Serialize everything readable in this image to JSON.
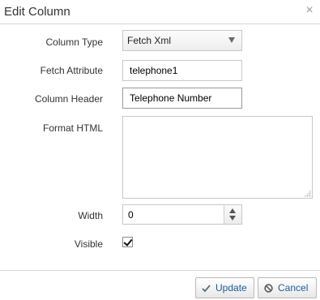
{
  "dialog": {
    "title": "Edit Column",
    "close_glyph": "×"
  },
  "form": {
    "column_type": {
      "label": "Column Type",
      "value": "Fetch Xml"
    },
    "fetch_attribute": {
      "label": "Fetch Attribute",
      "value": "telephone1"
    },
    "column_header": {
      "label": "Column Header",
      "value": "Telephone Number"
    },
    "format_html": {
      "label": "Format HTML",
      "value": ""
    },
    "width": {
      "label": "Width",
      "value": "0"
    },
    "visible": {
      "label": "Visible",
      "checked": true
    }
  },
  "footer": {
    "update_label": "Update",
    "cancel_label": "Cancel"
  },
  "icons": {
    "update": "check-icon",
    "cancel": "ban-icon",
    "close": "close-icon"
  },
  "colors": {
    "button_text": "#1f5b9a",
    "divider": "#d6d6d6"
  }
}
